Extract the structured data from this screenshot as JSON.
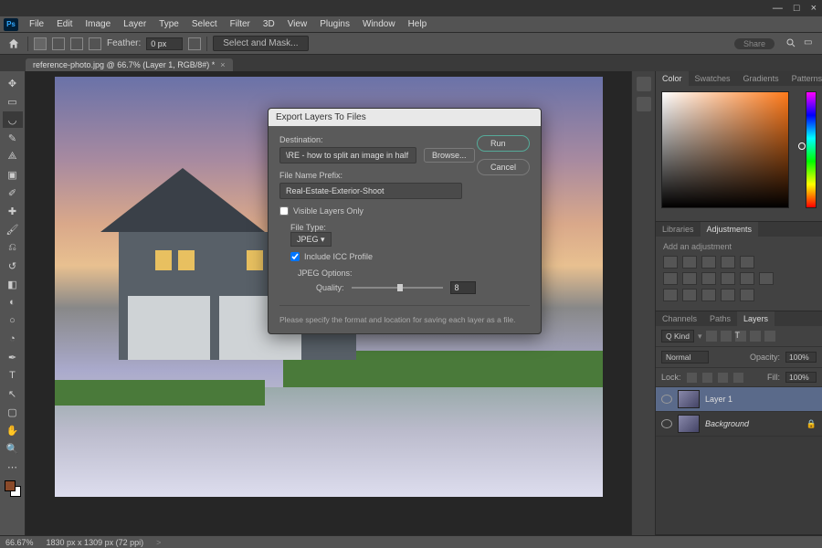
{
  "app": {
    "logo_text": "Ps"
  },
  "menus": [
    "File",
    "Edit",
    "Image",
    "Layer",
    "Type",
    "Select",
    "Filter",
    "3D",
    "View",
    "Plugins",
    "Window",
    "Help"
  ],
  "options": {
    "feather_label": "Feather:",
    "feather_value": "0 px",
    "mask_btn": "Select and Mask...",
    "share": "Share"
  },
  "doc_tab": {
    "title": "reference-photo.jpg @ 66.7% (Layer 1, RGB/8#) *",
    "close": "×"
  },
  "dialog": {
    "title": "Export Layers To Files",
    "destination_label": "Destination:",
    "destination_value": "\\RE - how to split an image in half",
    "browse": "Browse...",
    "run": "Run",
    "cancel": "Cancel",
    "prefix_label": "File Name Prefix:",
    "prefix_value": "Real-Estate-Exterior-Shoot",
    "visible_only": "Visible Layers Only",
    "filetype_label": "File Type:",
    "filetype_value": "JPEG",
    "icc": "Include ICC Profile",
    "jpeg_options": "JPEG Options:",
    "quality_label": "Quality:",
    "quality_value": "8",
    "help": "Please specify the format and location for saving each layer as a file."
  },
  "right": {
    "color_tabs": [
      "Color",
      "Swatches",
      "Gradients",
      "Patterns"
    ],
    "lib_tabs": [
      "Libraries",
      "Adjustments"
    ],
    "adj_hint": "Add an adjustment",
    "layer_tabs": [
      "Channels",
      "Paths",
      "Layers"
    ],
    "kind_label": "Q Kind",
    "blend_mode": "Normal",
    "opacity_label": "Opacity:",
    "opacity_value": "100%",
    "lock_label": "Lock:",
    "fill_label": "Fill:",
    "fill_value": "100%",
    "layers": [
      {
        "name": "Layer 1",
        "italic": false,
        "locked": false
      },
      {
        "name": "Background",
        "italic": true,
        "locked": true
      }
    ]
  },
  "status": {
    "zoom": "66.67%",
    "doc_info": "1830 px x 1309 px (72 ppi)",
    "arrow": ">"
  },
  "window_controls": {
    "min": "—",
    "max": "□",
    "close": "×"
  }
}
